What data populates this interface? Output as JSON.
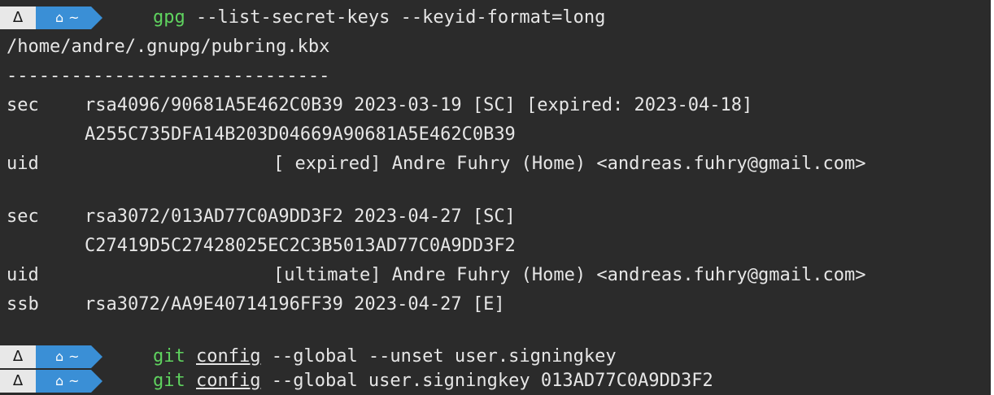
{
  "prompt": {
    "os_icon": "Δ",
    "dir_icon": "⌂",
    "dir_text": "~",
    "colors": {
      "os_segment": "#e8e8e8",
      "dir_segment": "#3a8fd6",
      "command_green": "#5fd35f",
      "background": "#2b2b2b",
      "text": "#e6e6e6"
    }
  },
  "command1": {
    "program": "gpg",
    "args": " --list-secret-keys --keyid-format=long"
  },
  "output": {
    "keyring_path": "/home/andre/.gnupg/pubring.kbx",
    "separator": "------------------------------",
    "key1": {
      "sec_tag": "sec",
      "sec_text": "rsa4096/90681A5E462C0B39 2023-03-19 [SC] [expired: 2023-04-18]",
      "fingerprint": "A255C735DFA14B203D04669A90681A5E462C0B39",
      "uid_tag": "uid",
      "uid_text": "[ expired] Andre Fuhry (Home) <andreas.fuhry@gmail.com>"
    },
    "key2": {
      "sec_tag": "sec",
      "sec_text": "rsa3072/013AD77C0A9DD3F2 2023-04-27 [SC]",
      "fingerprint": "C27419D5C27428025EC2C3B5013AD77C0A9DD3F2",
      "uid_tag": "uid",
      "uid_text": "[ultimate] Andre Fuhry (Home) <andreas.fuhry@gmail.com>",
      "ssb_tag": "ssb",
      "ssb_text": "rsa3072/AA9E40714196FF39 2023-04-27 [E]"
    }
  },
  "command2": {
    "program": "git",
    "subcommand": "config",
    "args": " --global --unset user.signingkey"
  },
  "command3": {
    "program": "git",
    "subcommand": "config",
    "args": " --global user.signingkey 013AD77C0A9DD3F2"
  }
}
